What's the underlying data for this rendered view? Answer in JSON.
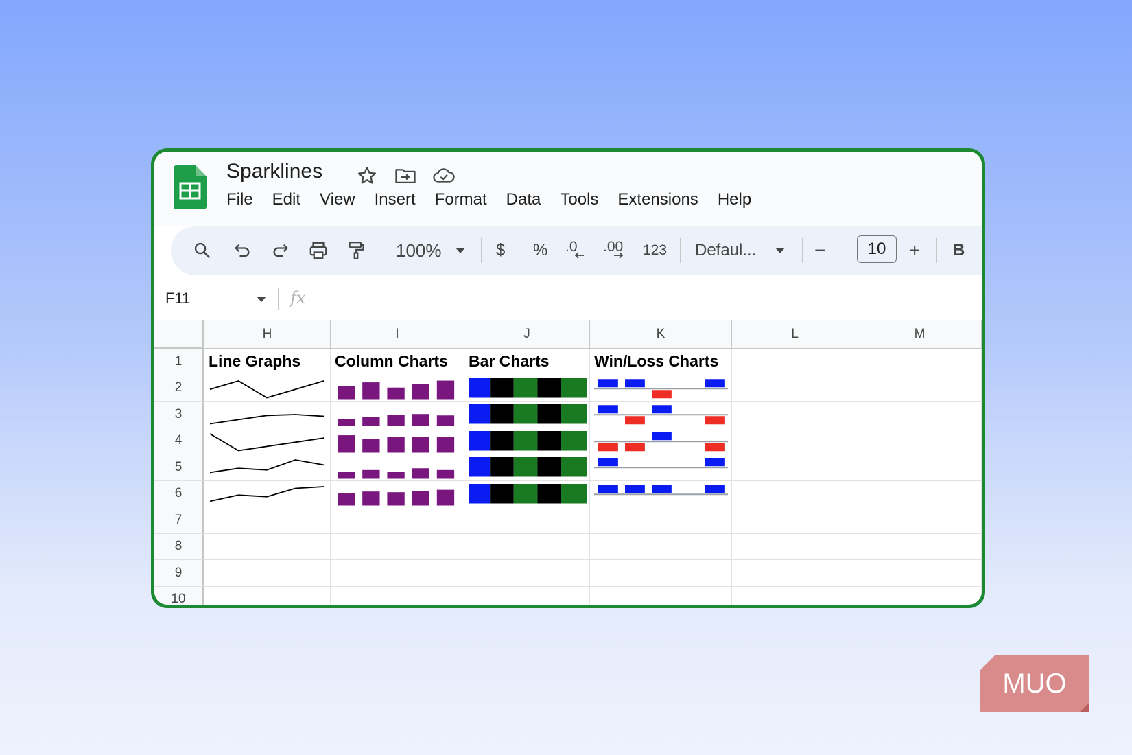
{
  "app": {
    "title": "Sparklines",
    "menu": [
      "File",
      "Edit",
      "View",
      "Insert",
      "Format",
      "Data",
      "Tools",
      "Extensions",
      "Help"
    ]
  },
  "toolbar": {
    "zoom": "100%",
    "currency": "$",
    "percent": "%",
    "dec_decrease": ".0",
    "dec_increase": ".00",
    "format_number": "123",
    "font": "Defaul...",
    "font_size": "10",
    "minus": "−",
    "plus": "+",
    "bold": "B"
  },
  "formula_bar": {
    "cell_ref": "F11",
    "fx": "fx"
  },
  "columns": [
    "H",
    "I",
    "J",
    "K",
    "L",
    "M"
  ],
  "row_numbers": [
    "1",
    "2",
    "3",
    "4",
    "5",
    "6",
    "7",
    "8",
    "9",
    "10"
  ],
  "headers": {
    "line": "Line Graphs",
    "column": "Column Charts",
    "bar": "Bar Charts",
    "winloss": "Win/Loss Charts"
  },
  "colors": {
    "line": "#000000",
    "column": "#7a177f",
    "bar": [
      "#0b1cf2",
      "#000000",
      "#1a7a21",
      "#000000",
      "#1a7a21"
    ],
    "win": "#0b1cf2",
    "loss": "#ee2d25",
    "axis": "#9aa0a6",
    "frame": "#1c8a32"
  },
  "sparklines": {
    "line": [
      [
        3,
        5,
        1,
        3,
        5
      ],
      [
        1,
        2,
        3,
        3.2,
        2.8
      ],
      [
        5,
        1,
        2,
        3,
        4
      ],
      [
        2,
        3,
        2.6,
        5,
        3.8
      ],
      [
        1.5,
        3,
        2.6,
        4.6,
        5
      ]
    ],
    "column": [
      [
        4,
        5,
        3.5,
        4.5,
        5.5
      ],
      [
        2,
        2.5,
        3.2,
        3.4,
        3
      ],
      [
        5,
        4,
        4.5,
        4.5,
        4.5
      ],
      [
        2,
        2.5,
        2,
        3,
        2.5
      ],
      [
        3.5,
        4,
        3.8,
        4.2,
        4.5
      ]
    ],
    "winloss": [
      [
        1,
        1,
        -1,
        0,
        1
      ],
      [
        1,
        -1,
        1,
        0,
        -1
      ],
      [
        -1,
        -1,
        1,
        0,
        -1
      ],
      [
        1,
        0,
        0,
        0,
        1
      ],
      [
        1,
        1,
        1,
        0,
        1
      ]
    ]
  },
  "watermark": "MUO"
}
